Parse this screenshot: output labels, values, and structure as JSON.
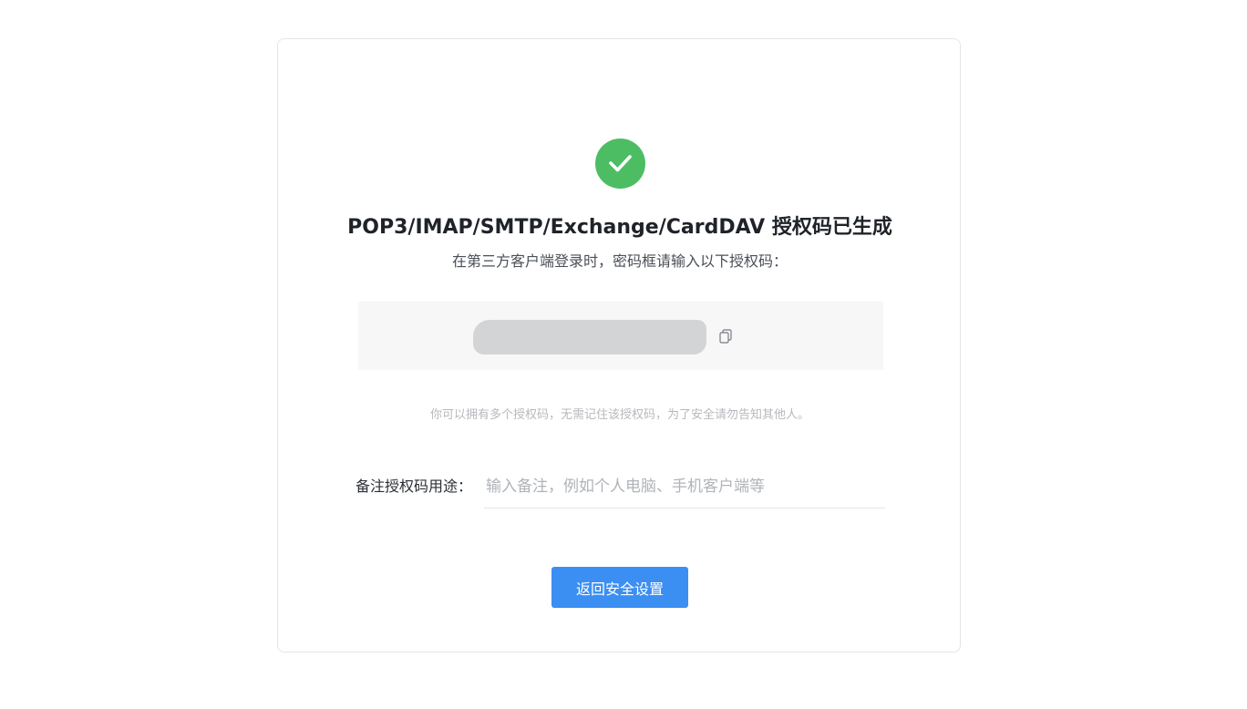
{
  "result": {
    "status_icon": "check-circle-icon",
    "success_color": "#4dbd63",
    "title": "POP3/IMAP/SMTP/Exchange/CardDAV 授权码已生成",
    "subtitle": "在第三方客户端登录时，密码框请输入以下授权码："
  },
  "auth_code": {
    "value_redacted": true,
    "copy_icon": "copy-icon"
  },
  "hint": "你可以拥有多个授权码，无需记住该授权码，为了安全请勿告知其他人。",
  "note": {
    "label": "备注授权码用途：",
    "value": "",
    "placeholder": "输入备注，例如个人电脑、手机客户端等"
  },
  "actions": {
    "return_label": "返回安全设置",
    "accent_color": "#3b8ff2"
  }
}
